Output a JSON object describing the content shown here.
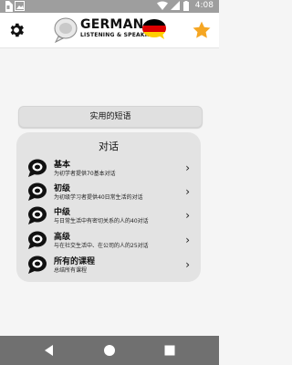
{
  "status": {
    "time": "4:08",
    "icons": [
      "sim-icon",
      "image-icon",
      "wifi-icon",
      "signal-icon",
      "battery-icon"
    ]
  },
  "appbar": {
    "logo_title": "GERMAN",
    "logo_subtitle": "LISTENING & SPEAKING",
    "settings_icon": "gear-icon",
    "favorite_icon": "star-icon",
    "accent": "#f5a623"
  },
  "phrases_button": {
    "label": "实用的短语"
  },
  "dialogs": {
    "title": "对话",
    "items": [
      {
        "label": "基本",
        "desc": "为初学者提供70基本对话"
      },
      {
        "label": "初级",
        "desc": "为初级学习者提供40日常生活的对话"
      },
      {
        "label": "中级",
        "desc": "与日常生活中有密切关系的人的40对话"
      },
      {
        "label": "高级",
        "desc": "与在社交生活中、在公司的人的25对话"
      },
      {
        "label": "所有的课程",
        "desc": "总结所有课程"
      }
    ]
  },
  "navbar": {
    "back_icon": "back-icon",
    "home_icon": "home-icon",
    "recents_icon": "recents-icon"
  }
}
